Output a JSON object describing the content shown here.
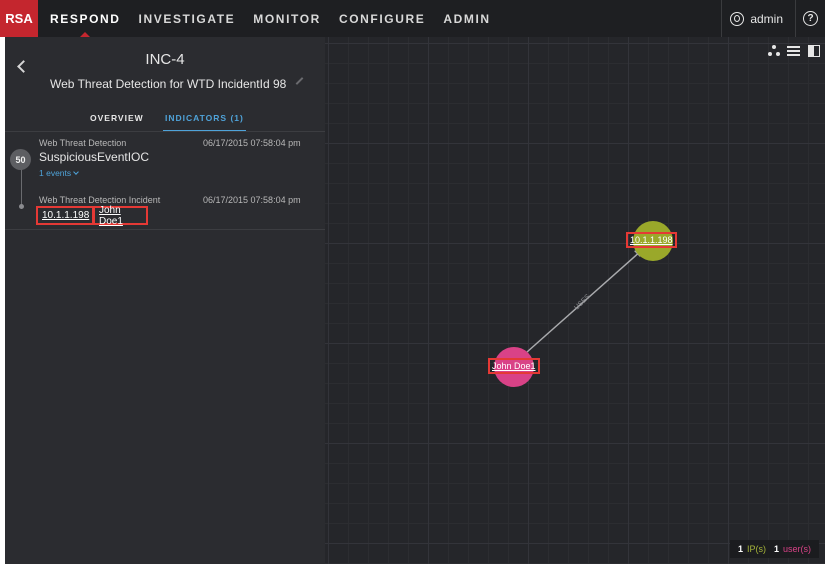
{
  "nav": {
    "logo": "RSA",
    "items": [
      "RESPOND",
      "INVESTIGATE",
      "MONITOR",
      "CONFIGURE",
      "ADMIN"
    ],
    "user": "admin",
    "help": "?"
  },
  "incident": {
    "id": "INC-4",
    "title": "Web Threat Detection for WTD IncidentId 98"
  },
  "tabs": [
    "OVERVIEW",
    "INDICATORS (1)"
  ],
  "indicator": {
    "score": "50",
    "source": "Web Threat Detection",
    "date": "06/17/2015 07:58:04 pm",
    "name": "SuspiciousEventIOC",
    "events": "1 events",
    "sub_source": "Web Threat Detection Incident",
    "sub_date": "06/17/2015 07:58:04 pm",
    "entities": [
      "10.1.1.198",
      "John Doe1"
    ]
  },
  "graph": {
    "nodes": [
      {
        "label": "10.1.1.198",
        "color": "#9aa82a"
      },
      {
        "label": "John Doe1",
        "color": "#d94287"
      }
    ],
    "edge_label": "USES",
    "legend": {
      "ip_count": "1",
      "ip_label": "IP(s)",
      "user_count": "1",
      "user_label": "user(s)"
    }
  }
}
